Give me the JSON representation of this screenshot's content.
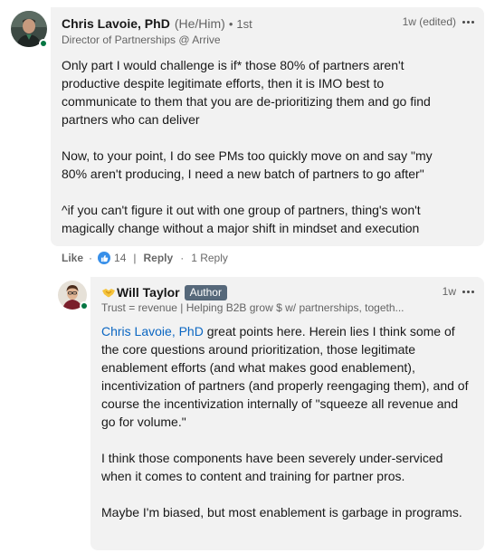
{
  "comment": {
    "author_name": "Chris Lavoie, PhD",
    "pronouns": "(He/Him)",
    "separator": "•",
    "degree": "1st",
    "headline": "Director of Partnerships @ Arrive",
    "timestamp": "1w (edited)",
    "paragraphs": [
      "Only part I would challenge is if* those 80% of partners aren't productive despite legitimate efforts, then it is IMO best to communicate to them that you are de-prioritizing them and go find partners who can deliver",
      "Now, to your point, I do see PMs too quickly move on and say \"my 80% aren't producing, I need a new batch of partners to go after\"",
      "^if you can't figure it out with one group of partners, thing's won't magically change without a major shift in mindset and execution"
    ],
    "actions": {
      "like_label": "Like",
      "like_count": "14",
      "reply_label": "Reply",
      "replies_count": "1 Reply"
    },
    "avatar_icon": "profile-photo-icon",
    "status_color": "#057642"
  },
  "reply": {
    "author_name": "Will Taylor",
    "emoji_icon": "handshake-icon",
    "badge": "Author",
    "headline": "Trust = revenue | Helping B2B grow $ w/ partnerships, togeth...",
    "timestamp": "1w",
    "mention": "Chris Lavoie, PhD",
    "first_paragraph_rest": " great points here. Herein lies I think some of the core questions around prioritization, those legitimate enablement efforts (and what makes good enablement), incentivization of partners (and properly reengaging them), and of course the incentivization internally of \"squeeze all revenue and go for volume.\"",
    "paragraphs": [
      "I think those components have been severely under-serviced when it comes to content and training for partner pros.",
      "Maybe I'm biased, but most enablement is garbage in programs."
    ],
    "avatar_icon": "profile-photo-icon",
    "mention_color": "#0a66c2",
    "badge_color": "#56687a"
  }
}
